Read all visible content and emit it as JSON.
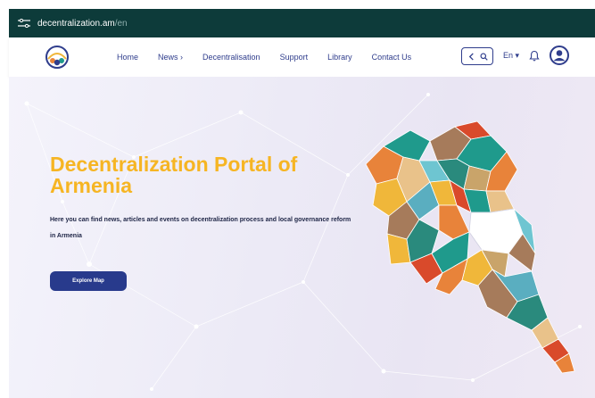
{
  "browser": {
    "url_domain": "decentralization.am",
    "url_path": "/en"
  },
  "nav": {
    "items": [
      {
        "id": "home",
        "label": "Home"
      },
      {
        "id": "news",
        "label": "News ›"
      },
      {
        "id": "decentralisation",
        "label": "Decentralisation"
      },
      {
        "id": "support",
        "label": "Support"
      },
      {
        "id": "library",
        "label": "Library"
      },
      {
        "id": "contact",
        "label": "Contact Us"
      }
    ],
    "language": "En ▾",
    "icons": [
      "chevron-left-icon",
      "search-icon",
      "bell-icon",
      "user-avatar-icon"
    ]
  },
  "hero": {
    "title": "Decentralization Portal of Armenia",
    "description": "Here you can find news, articles and events on decentralization process and local governance reform in Armenia",
    "cta_label": "Explore Map"
  },
  "colors": {
    "header_bar": "#0d3b3a",
    "nav_text": "#2f3d8c",
    "title": "#f6b523",
    "button": "#283a8c",
    "map_palette": [
      "#e8833a",
      "#1f9a8c",
      "#a67b5b",
      "#f0b73a",
      "#6ec5d1",
      "#d94a2b",
      "#c9a46a",
      "#2a8a7d",
      "#e9c28a",
      "#5aaec0"
    ]
  }
}
